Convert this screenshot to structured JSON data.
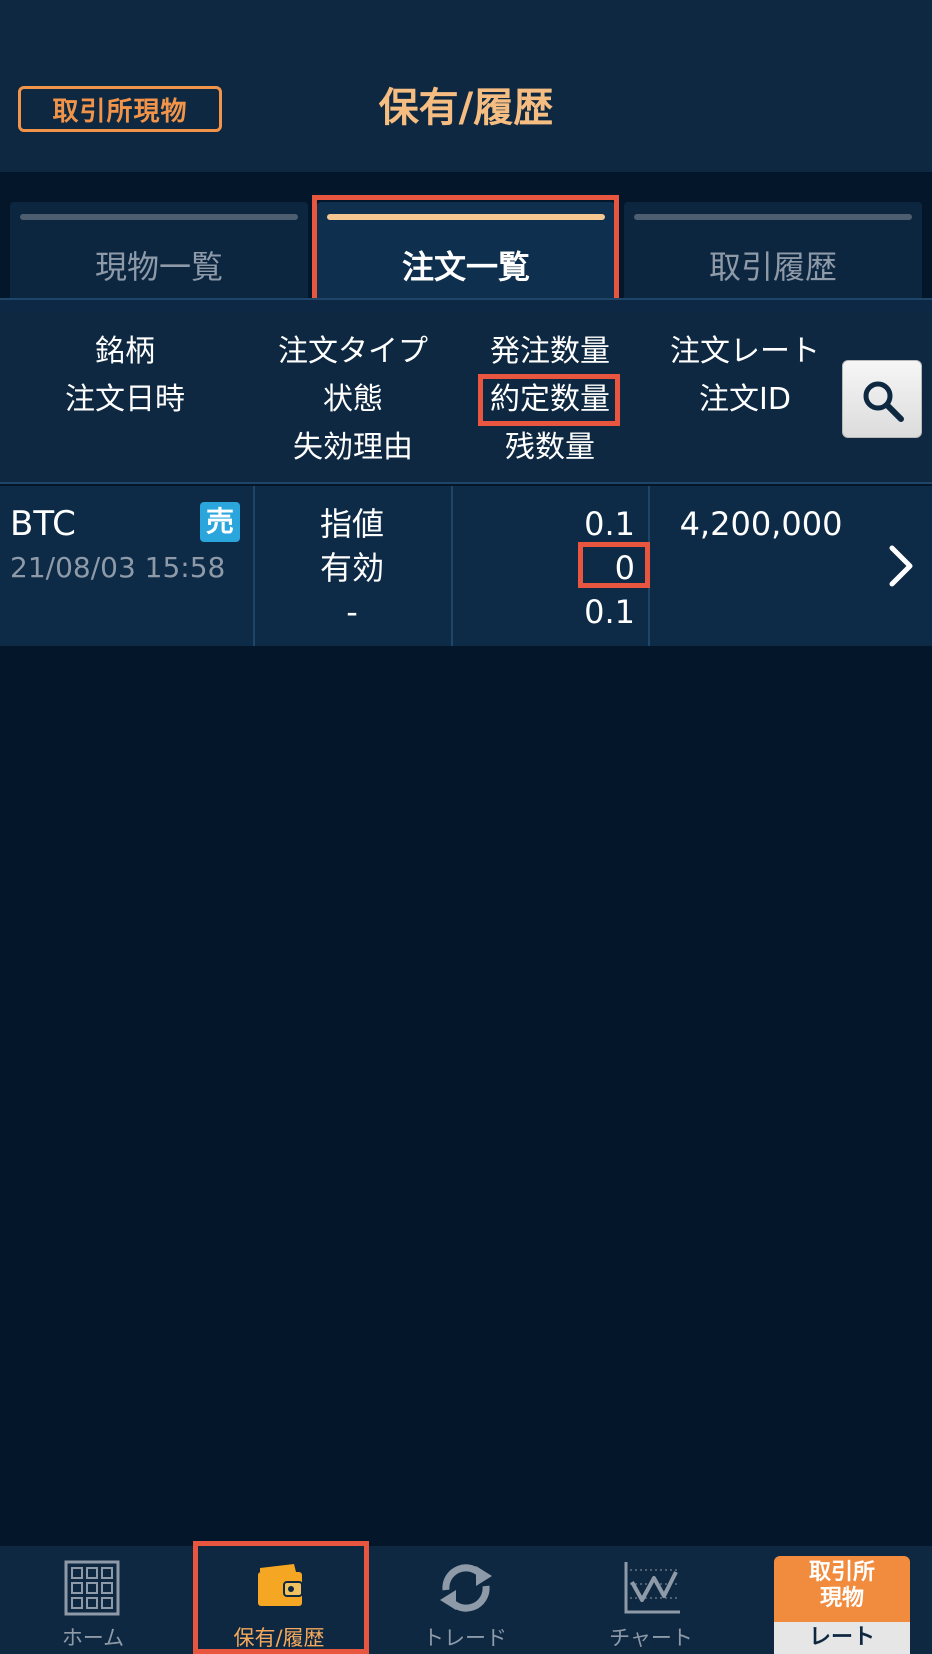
{
  "header": {
    "mode_badge": "取引所現物",
    "title": "保有/履歴"
  },
  "tabs": [
    {
      "label": "現物一覧",
      "active": false
    },
    {
      "label": "注文一覧",
      "active": true
    },
    {
      "label": "取引履歴",
      "active": false
    }
  ],
  "columns": {
    "col1": [
      "銘柄",
      "注文日時"
    ],
    "col2": [
      "注文タイプ",
      "状態",
      "失効理由"
    ],
    "col3": [
      "発注数量",
      "約定数量",
      "残数量"
    ],
    "col4": [
      "注文レート",
      "注文ID"
    ]
  },
  "search_icon": "search-icon",
  "orders": [
    {
      "symbol": "BTC",
      "side_badge": "売",
      "datetime": "21/08/03 15:58",
      "order_type": "指値",
      "status": "有効",
      "expire_reason": "-",
      "order_qty": "0.1",
      "filled_qty": "0",
      "remaining_qty": "0.1",
      "rate": "4,200,000"
    }
  ],
  "bottom_nav": [
    {
      "label": "ホーム",
      "icon": "grid-icon"
    },
    {
      "label": "保有/履歴",
      "icon": "wallet-icon",
      "active": true
    },
    {
      "label": "トレード",
      "icon": "refresh-icon"
    },
    {
      "label": "チャート",
      "icon": "chart-icon"
    }
  ],
  "rate_button": {
    "top": "取引所\n現物",
    "top_line1": "取引所",
    "top_line2": "現物",
    "bottom": "レート"
  },
  "colors": {
    "accent": "#f1944a",
    "highlight": "#e8563f",
    "sell": "#2aa6dd",
    "background": "#03162a"
  }
}
